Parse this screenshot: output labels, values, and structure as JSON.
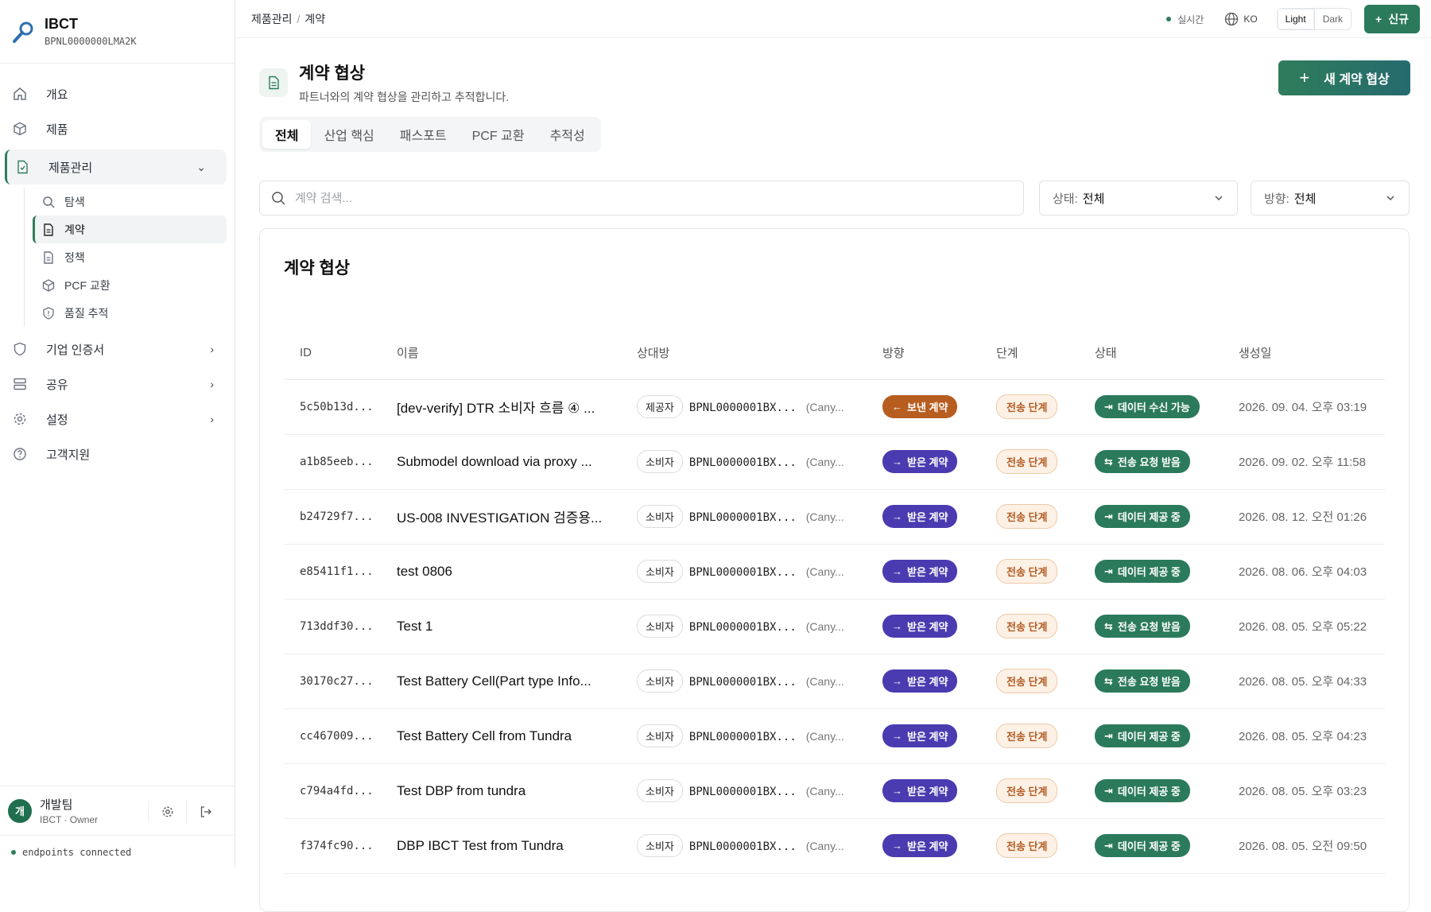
{
  "brand": {
    "title": "IBCT",
    "bpn": "BPNL0000000LMA2K"
  },
  "sidebar": {
    "items": [
      {
        "label": "개요",
        "icon": "home-icon"
      },
      {
        "label": "제품",
        "icon": "box-icon"
      }
    ],
    "group": {
      "label": "제품관리",
      "sub": [
        {
          "label": "탐색",
          "icon": "search-icon"
        },
        {
          "label": "계약",
          "icon": "contract-icon"
        },
        {
          "label": "정책",
          "icon": "document-icon"
        },
        {
          "label": "PCF 교환",
          "icon": "cube-icon"
        },
        {
          "label": "품질 추적",
          "icon": "shield-icon"
        }
      ]
    },
    "items2": [
      {
        "label": "기업 인증서",
        "icon": "shield-icon"
      },
      {
        "label": "공유",
        "icon": "server-icon"
      },
      {
        "label": "설정",
        "icon": "gear-icon"
      },
      {
        "label": "고객지원",
        "icon": "help-icon"
      }
    ],
    "user": {
      "avatar": "개",
      "name": "개발팀",
      "role": "IBCT · Owner"
    },
    "status": "endpoints connected"
  },
  "topbar": {
    "breadcrumb": [
      "제품관리",
      "계약"
    ],
    "live": "실시간",
    "lang": "KO",
    "theme_light": "Light",
    "theme_dark": "Dark",
    "new_label": "신규"
  },
  "page": {
    "title": "계약 협상",
    "desc": "파트너와의 계약 협상을 관리하고 추적합니다.",
    "create_label": "새 계약 협상",
    "tabs": [
      "전체",
      "산업 핵심",
      "패스포트",
      "PCF 교환",
      "추적성"
    ],
    "search_placeholder": "계약 검색...",
    "filter_status": {
      "label": "상태:",
      "value": "전체"
    },
    "filter_direction": {
      "label": "방향:",
      "value": "전체"
    },
    "card_title": "계약 협상"
  },
  "table": {
    "headers": [
      "ID",
      "이름",
      "상대방",
      "방향",
      "단계",
      "상태",
      "생성일"
    ],
    "rows": [
      {
        "id": "5c50b13d...",
        "name": "[dev-verify] DTR 소비자 흐름 ④ ...",
        "role": "제공자",
        "bpn": "BPNL0000001BX...",
        "cp": "(Cany...",
        "dir": "보낸 계약",
        "dir_type": "sent",
        "phase": "전송 단계",
        "state": "데이터 수신 가능",
        "date": "2026. 09. 04. 오후 03:19"
      },
      {
        "id": "a1b85eeb...",
        "name": "Submodel download via proxy ...",
        "role": "소비자",
        "bpn": "BPNL0000001BX...",
        "cp": "(Cany...",
        "dir": "받은 계약",
        "dir_type": "recv",
        "phase": "전송 단계",
        "state": "전송 요청 받음",
        "date": "2026. 09. 02. 오후 11:58"
      },
      {
        "id": "b24729f7...",
        "name": "US-008 INVESTIGATION 검증용...",
        "role": "소비자",
        "bpn": "BPNL0000001BX...",
        "cp": "(Cany...",
        "dir": "받은 계약",
        "dir_type": "recv",
        "phase": "전송 단계",
        "state": "데이터 제공 중",
        "date": "2026. 08. 12. 오전 01:26"
      },
      {
        "id": "e85411f1...",
        "name": "test 0806",
        "role": "소비자",
        "bpn": "BPNL0000001BX...",
        "cp": "(Cany...",
        "dir": "받은 계약",
        "dir_type": "recv",
        "phase": "전송 단계",
        "state": "데이터 제공 중",
        "date": "2026. 08. 06. 오후 04:03"
      },
      {
        "id": "713ddf30...",
        "name": "Test 1",
        "role": "소비자",
        "bpn": "BPNL0000001BX...",
        "cp": "(Cany...",
        "dir": "받은 계약",
        "dir_type": "recv",
        "phase": "전송 단계",
        "state": "전송 요청 받음",
        "date": "2026. 08. 05. 오후 05:22"
      },
      {
        "id": "30170c27...",
        "name": "Test Battery Cell(Part type Info...",
        "role": "소비자",
        "bpn": "BPNL0000001BX...",
        "cp": "(Cany...",
        "dir": "받은 계약",
        "dir_type": "recv",
        "phase": "전송 단계",
        "state": "전송 요청 받음",
        "date": "2026. 08. 05. 오후 04:33"
      },
      {
        "id": "cc467009...",
        "name": "Test Battery Cell from Tundra",
        "role": "소비자",
        "bpn": "BPNL0000001BX...",
        "cp": "(Cany...",
        "dir": "받은 계약",
        "dir_type": "recv",
        "phase": "전송 단계",
        "state": "데이터 제공 중",
        "date": "2026. 08. 05. 오후 04:23"
      },
      {
        "id": "c794a4fd...",
        "name": "Test DBP from tundra",
        "role": "소비자",
        "bpn": "BPNL0000001BX...",
        "cp": "(Cany...",
        "dir": "받은 계약",
        "dir_type": "recv",
        "phase": "전송 단계",
        "state": "데이터 제공 중",
        "date": "2026. 08. 05. 오후 03:23"
      },
      {
        "id": "f374fc90...",
        "name": "DBP IBCT Test from Tundra",
        "role": "소비자",
        "bpn": "BPNL0000001BX...",
        "cp": "(Cany...",
        "dir": "받은 계약",
        "dir_type": "recv",
        "phase": "전송 단계",
        "state": "데이터 제공 중",
        "date": "2026. 08. 05. 오전 09:50"
      }
    ]
  },
  "colors": {
    "accent": "#2b7a5c",
    "sent": "#b75d1f",
    "received": "#4a3bb0",
    "phase_bg": "#fdf1e6"
  }
}
